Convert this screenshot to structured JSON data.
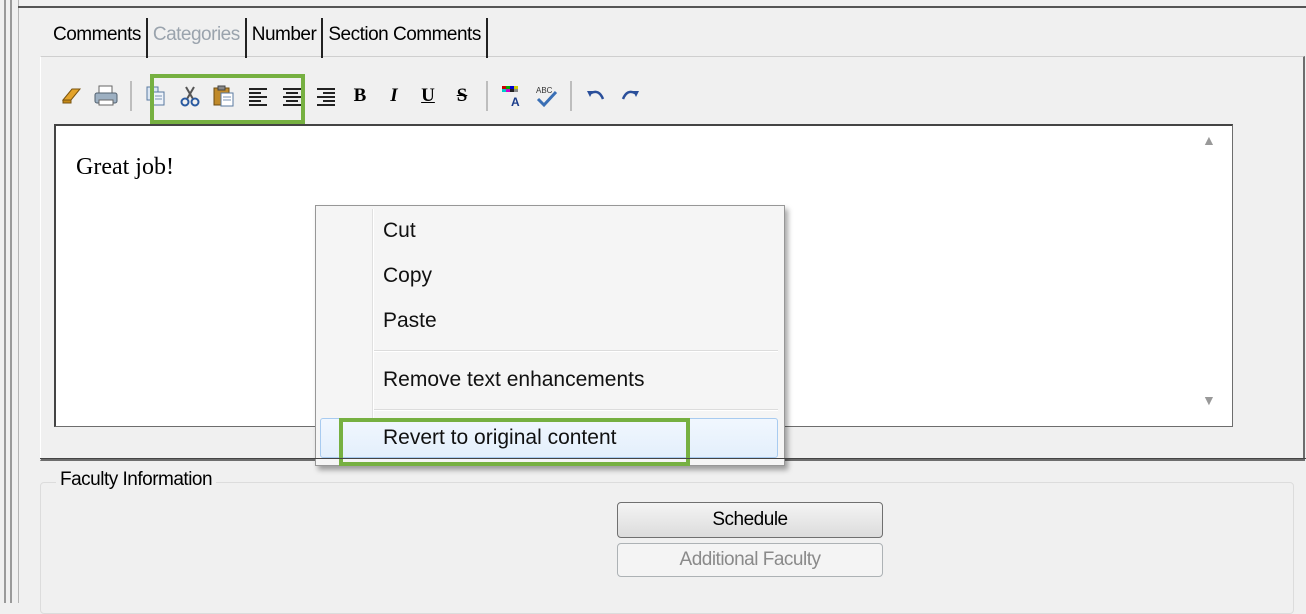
{
  "tabs": [
    {
      "label": "Comments",
      "enabled": true,
      "selected": true
    },
    {
      "label": "Categories",
      "enabled": false,
      "selected": false
    },
    {
      "label": "Number",
      "enabled": true,
      "selected": false
    },
    {
      "label": "Section Comments",
      "enabled": true,
      "selected": false
    }
  ],
  "toolbar": {
    "icons": [
      "eraser-icon",
      "print-icon",
      "copy-icon",
      "cut-icon",
      "paste-icon",
      "align-left-icon",
      "align-center-icon",
      "align-right-icon",
      "bold-icon",
      "italic-icon",
      "underline-icon",
      "strikethrough-icon",
      "text-color-icon",
      "spellcheck-icon",
      "undo-icon",
      "redo-icon"
    ],
    "bold_label": "B",
    "italic_label": "I",
    "underline_label": "U",
    "strike_label": "S"
  },
  "editor": {
    "text": "Great job!"
  },
  "context_menu": {
    "items": [
      {
        "label": "Cut"
      },
      {
        "label": "Copy"
      },
      {
        "label": "Paste"
      },
      {
        "label": "Remove text enhancements"
      },
      {
        "label": "Revert to original content",
        "highlighted": true
      }
    ]
  },
  "faculty": {
    "group_label": "Faculty Information",
    "schedule_label": "Schedule",
    "additional_label": "Additional Faculty"
  },
  "colors": {
    "highlight": "#76b041",
    "disabled_text": "#9aa3ad"
  }
}
